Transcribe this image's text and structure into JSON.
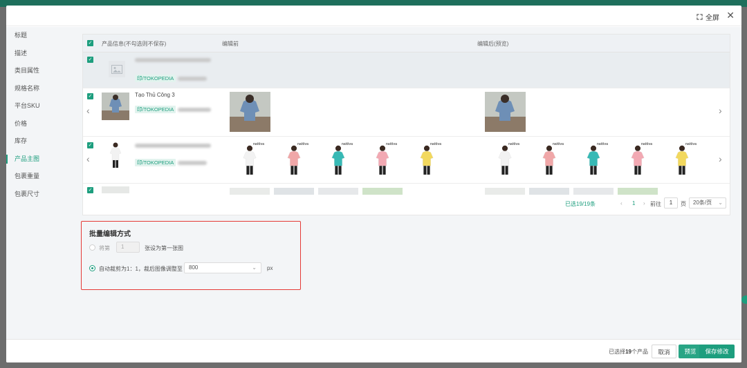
{
  "header": {
    "fullscreen_label": "全屏"
  },
  "sidebar": {
    "items": [
      {
        "label": "标题"
      },
      {
        "label": "描述"
      },
      {
        "label": "类目属性"
      },
      {
        "label": "规格名称"
      },
      {
        "label": "平台SKU"
      },
      {
        "label": "价格"
      },
      {
        "label": "库存"
      },
      {
        "label": "产品主图",
        "active": true
      },
      {
        "label": "包裹重量"
      },
      {
        "label": "包裹尺寸"
      }
    ]
  },
  "table": {
    "columns": [
      "产品信息(不勾选则不保存)",
      "编辑前",
      "编辑后(预览)"
    ],
    "rows": [
      {
        "name": "",
        "tag": "印/TOKOPEDIA"
      },
      {
        "name": "Tạo Thủ Công 3",
        "tag": "印/TOKOPEDIA"
      },
      {
        "name": "",
        "tag": "印/TOKOPEDIA"
      }
    ],
    "brand_logo": "nattiva",
    "shirt_colors": [
      "#f2f2f2",
      "#f0a7a8",
      "#37b9b5",
      "#f2a9b3",
      "#f2d85e"
    ]
  },
  "pager": {
    "selected": "已选19/19条",
    "current_page": "1",
    "goto_label": "前往",
    "goto_value": "1",
    "page_suffix": "页",
    "page_size": "20条/页"
  },
  "batch": {
    "title": "批量编辑方式",
    "option1_prefix": "将第",
    "option1_value": "1",
    "option1_suffix": "张设为第一张图",
    "option2_label": "自动裁剪为1：1，裁后图像调整至",
    "option2_value": "800",
    "option2_unit": "px"
  },
  "footer": {
    "selected_prefix": "已选择",
    "selected_count": "19",
    "selected_suffix": "个产品",
    "cancel_label": "取消",
    "preview_label": "预览",
    "save_label": "保存修改"
  },
  "colors": {
    "accent": "#1d9e7e",
    "highlight_border": "#e53935"
  }
}
